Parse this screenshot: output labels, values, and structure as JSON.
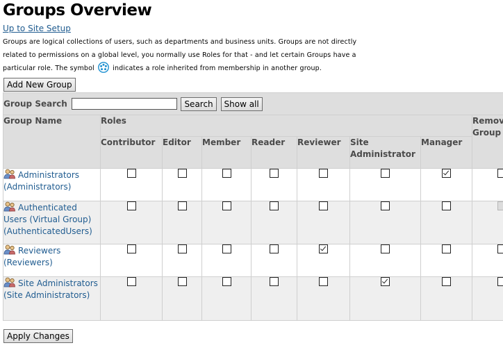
{
  "page": {
    "title": "Groups Overview",
    "up_link": "Up to Site Setup",
    "description_part1": "Groups are logical collections of users, such as departments and business units. Groups are not directly related to permissions on a global level, you normally use Roles for that - and let certain Groups have a particular role. The symbol",
    "description_part2": "indicates a role inherited from membership in another group.",
    "add_group_label": "Add New Group",
    "apply_label": "Apply Changes"
  },
  "search": {
    "label": "Group Search",
    "value": "",
    "search_label": "Search",
    "show_all_label": "Show all"
  },
  "table": {
    "group_name_header": "Group Name",
    "roles_header": "Roles",
    "remove_header": "Remove Group",
    "roles": [
      "Contributor",
      "Editor",
      "Member",
      "Reader",
      "Reviewer",
      "Site Administrator",
      "Manager"
    ],
    "rows": [
      {
        "name": "Administrators (Administrators)",
        "roles": [
          false,
          false,
          false,
          false,
          false,
          false,
          true
        ],
        "remove": "enabled"
      },
      {
        "name": "Authenticated Users (Virtual Group) (AuthenticatedUsers)",
        "roles": [
          false,
          false,
          false,
          false,
          false,
          false,
          false
        ],
        "remove": "disabled"
      },
      {
        "name": "Reviewers (Reviewers)",
        "roles": [
          false,
          false,
          false,
          false,
          true,
          false,
          false
        ],
        "remove": "enabled"
      },
      {
        "name": "Site Administrators (Site Administrators)",
        "roles": [
          false,
          false,
          false,
          false,
          false,
          true,
          false
        ],
        "remove": "enabled"
      }
    ]
  },
  "icons": {
    "inherited": "inherited-role-icon",
    "group": "group-icon"
  },
  "colors": {
    "link": "#205c90",
    "header_bg": "#dedede",
    "alt_row_bg": "#efefef",
    "inherit_icon": "#1a8fd0"
  }
}
